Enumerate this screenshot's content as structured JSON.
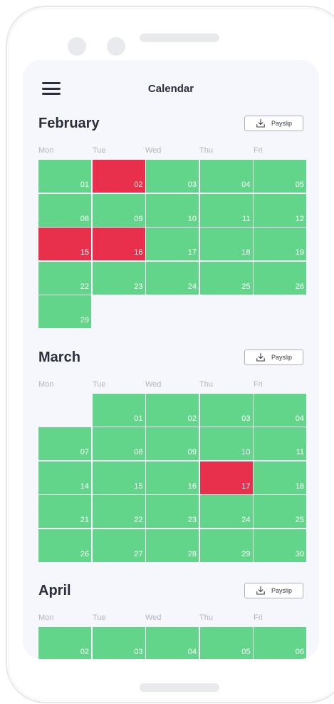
{
  "header": {
    "title": "Calendar",
    "menu_icon": "hamburger-menu-icon"
  },
  "colors": {
    "worked": "#62d58b",
    "absent": "#e8304c",
    "background": "#f6f7fd"
  },
  "payslip_label": "Payslip",
  "weekdays": [
    "Mon",
    "Tue",
    "Wed",
    "Thu",
    "Fri"
  ],
  "months": [
    {
      "name": "February",
      "payslip_label": "Payslip",
      "weekdays": [
        "Mon",
        "Tue",
        "Wed",
        "Thu",
        "Fri"
      ],
      "weeks": [
        [
          {
            "day": "01",
            "status": "green"
          },
          {
            "day": "02",
            "status": "red"
          },
          {
            "day": "03",
            "status": "green"
          },
          {
            "day": "04",
            "status": "green"
          },
          {
            "day": "05",
            "status": "green"
          }
        ],
        [
          {
            "day": "08",
            "status": "green"
          },
          {
            "day": "09",
            "status": "green"
          },
          {
            "day": "10",
            "status": "green"
          },
          {
            "day": "11",
            "status": "green"
          },
          {
            "day": "12",
            "status": "green"
          }
        ],
        [
          {
            "day": "15",
            "status": "red"
          },
          {
            "day": "16",
            "status": "red"
          },
          {
            "day": "17",
            "status": "green"
          },
          {
            "day": "18",
            "status": "green"
          },
          {
            "day": "19",
            "status": "green"
          }
        ],
        [
          {
            "day": "22",
            "status": "green"
          },
          {
            "day": "23",
            "status": "green"
          },
          {
            "day": "24",
            "status": "green"
          },
          {
            "day": "25",
            "status": "green"
          },
          {
            "day": "26",
            "status": "green"
          }
        ],
        [
          {
            "day": "29",
            "status": "green"
          },
          null,
          null,
          null,
          null
        ]
      ]
    },
    {
      "name": "March",
      "payslip_label": "Payslip",
      "weekdays": [
        "Mon",
        "Tue",
        "Wed",
        "Thu",
        "Fri"
      ],
      "weeks": [
        [
          null,
          {
            "day": "01",
            "status": "green"
          },
          {
            "day": "02",
            "status": "green"
          },
          {
            "day": "03",
            "status": "green"
          },
          {
            "day": "04",
            "status": "green"
          }
        ],
        [
          {
            "day": "07",
            "status": "green"
          },
          {
            "day": "08",
            "status": "green"
          },
          {
            "day": "09",
            "status": "green"
          },
          {
            "day": "10",
            "status": "green"
          },
          {
            "day": "11",
            "status": "green"
          }
        ],
        [
          {
            "day": "14",
            "status": "green"
          },
          {
            "day": "15",
            "status": "green"
          },
          {
            "day": "16",
            "status": "green"
          },
          {
            "day": "17",
            "status": "red"
          },
          {
            "day": "18",
            "status": "green"
          }
        ],
        [
          {
            "day": "21",
            "status": "green"
          },
          {
            "day": "22",
            "status": "green"
          },
          {
            "day": "23",
            "status": "green"
          },
          {
            "day": "24",
            "status": "green"
          },
          {
            "day": "25",
            "status": "green"
          }
        ],
        [
          {
            "day": "26",
            "status": "green"
          },
          {
            "day": "27",
            "status": "green"
          },
          {
            "day": "28",
            "status": "green"
          },
          {
            "day": "29",
            "status": "green"
          },
          {
            "day": "30",
            "status": "green"
          }
        ]
      ]
    },
    {
      "name": "April",
      "payslip_label": "Payslip",
      "weekdays": [
        "Mon",
        "Tue",
        "Wed",
        "Thu",
        "Fri"
      ],
      "weeks": [
        [
          {
            "day": "02",
            "status": "green"
          },
          {
            "day": "03",
            "status": "green"
          },
          {
            "day": "04",
            "status": "green"
          },
          {
            "day": "05",
            "status": "green"
          },
          {
            "day": "06",
            "status": "green"
          }
        ]
      ]
    }
  ]
}
